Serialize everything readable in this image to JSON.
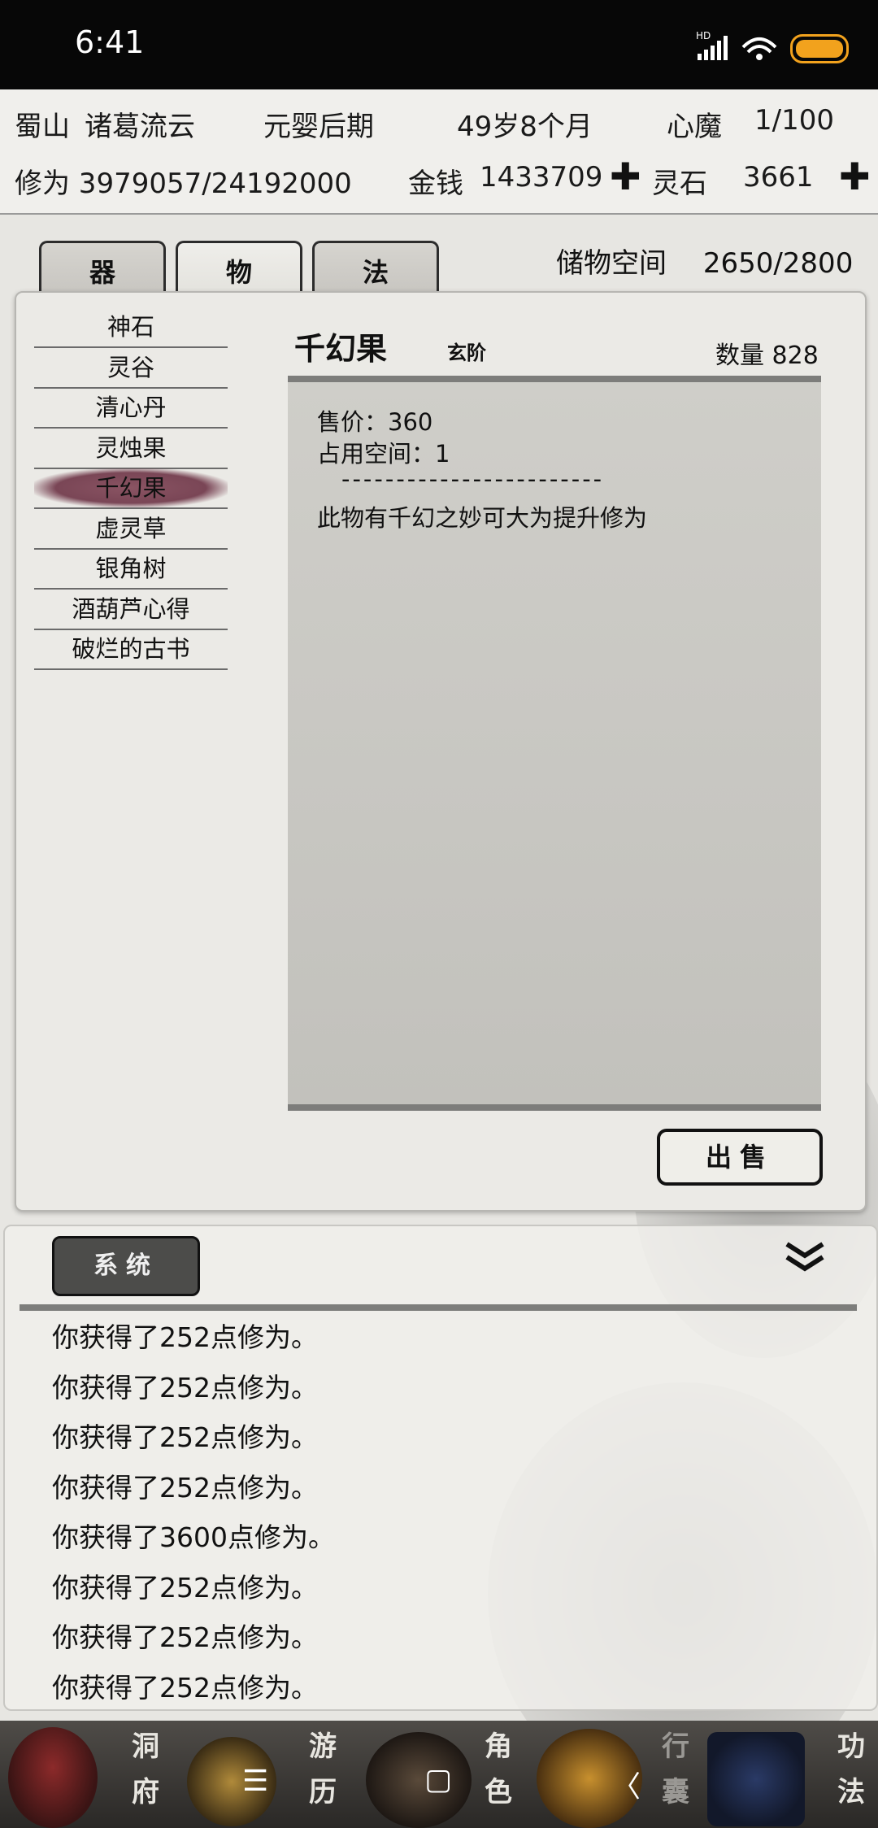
{
  "status_bar": {
    "time": "6:41",
    "hd": "HD"
  },
  "info": {
    "sect": "蜀山",
    "name": "诸葛流云",
    "realm": "元婴后期",
    "age": "49岁8个月",
    "demon_label": "心魔",
    "demon_value": "1/100",
    "cultivation": "修为 3979057/24192000",
    "money_label": "金钱",
    "money_value": "1433709",
    "stone_label": "灵石",
    "stone_value": "3661",
    "plus_symbol": "✚"
  },
  "tabs": [
    {
      "label": "器",
      "active": false
    },
    {
      "label": "物",
      "active": true
    },
    {
      "label": "法",
      "active": false
    }
  ],
  "storage": {
    "label": "储物空间",
    "value": "2650/2800"
  },
  "items": [
    "神石",
    "灵谷",
    "清心丹",
    "灵烛果",
    "千幻果",
    "虚灵草",
    "银角树",
    "酒葫芦心得",
    "破烂的古书"
  ],
  "selected_index": 4,
  "detail": {
    "name": "千幻果",
    "grade": "玄阶",
    "quantity": "数量 828",
    "price": "售价：360",
    "space": "占用空间：1",
    "divider": "------------------------",
    "description": "此物有千幻之妙可大为提升修为"
  },
  "sell_button": "出售",
  "log": {
    "tab_label": "系统",
    "collapse_icon": "double-chevron-down",
    "lines": [
      "你获得了252点修为。",
      "你获得了252点修为。",
      "你获得了252点修为。",
      "你获得了252点修为。",
      "你获得了3600点修为。",
      "你获得了252点修为。",
      "你获得了252点修为。",
      "你获得了252点修为。"
    ]
  },
  "bottom_nav": [
    {
      "top": "洞",
      "bottom": "府"
    },
    {
      "top": "游",
      "bottom": "历"
    },
    {
      "top": "角",
      "bottom": "色"
    },
    {
      "top": "行",
      "bottom": "囊"
    },
    {
      "top": "功",
      "bottom": "法"
    }
  ],
  "system_nav": {
    "menu": "☰",
    "home": "▢",
    "back": "〈"
  },
  "colors": {
    "accent_selected": "#7a4656",
    "battery": "#f2a21d"
  }
}
